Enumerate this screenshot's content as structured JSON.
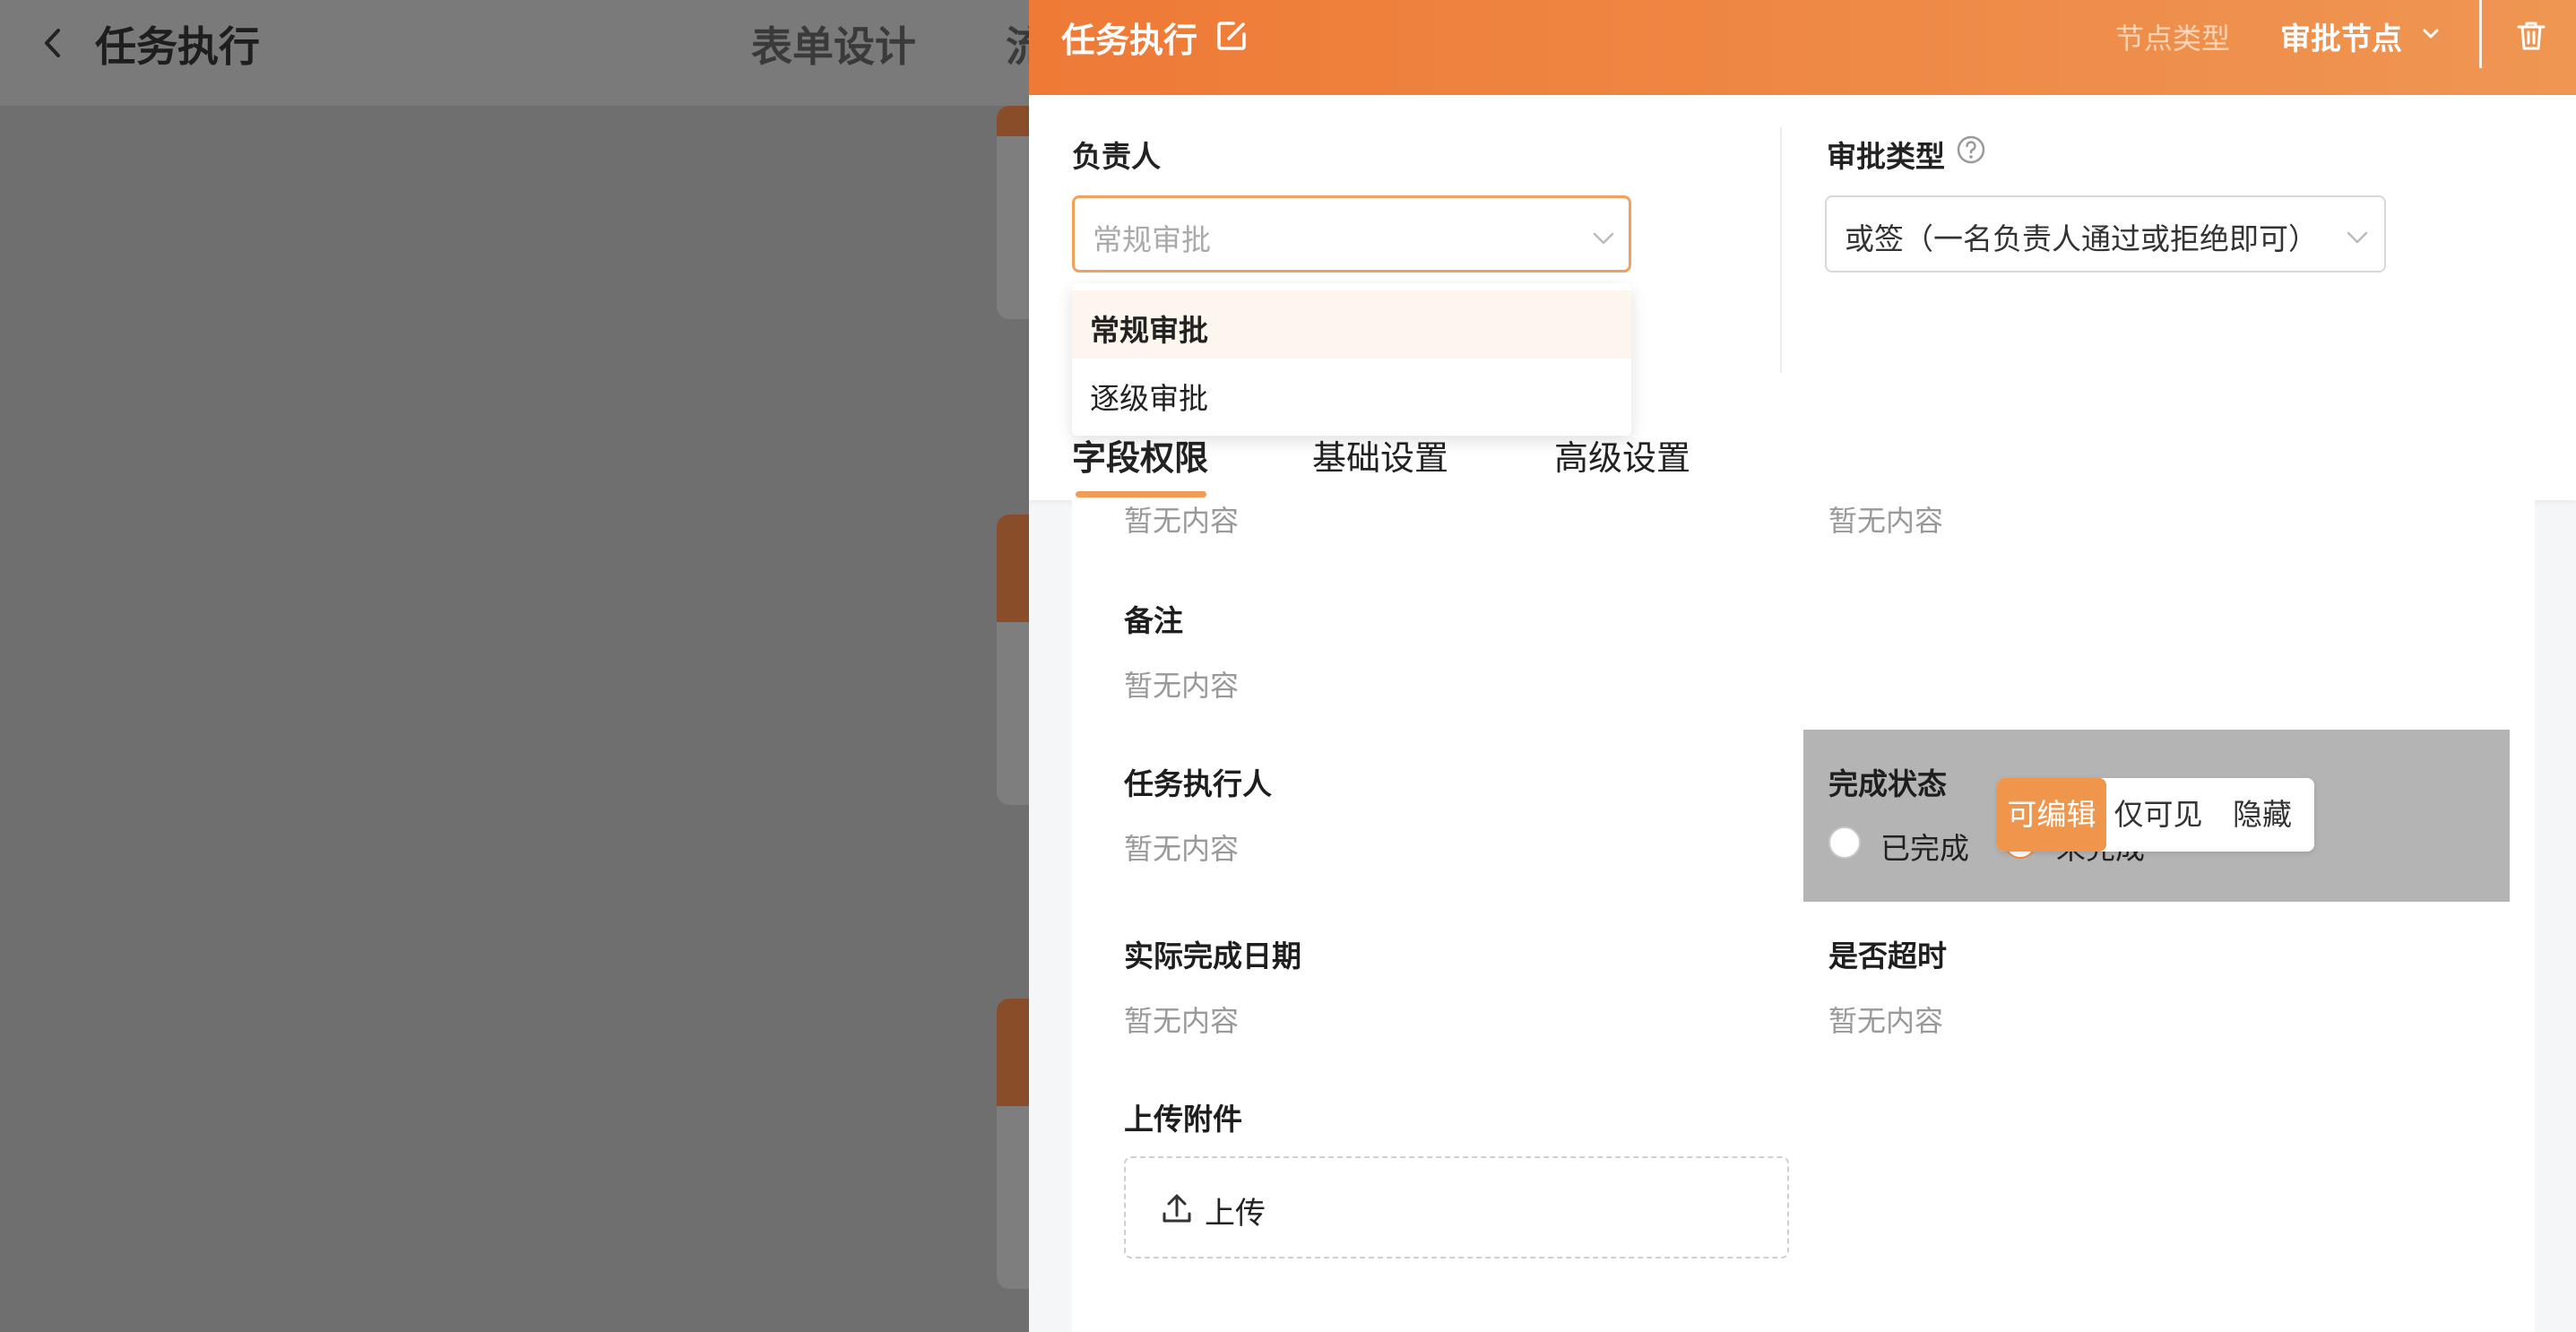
{
  "app": {
    "title": "任务执行",
    "tabs": [
      "表单设计",
      "流"
    ]
  },
  "drawer": {
    "title": "任务执行",
    "node_type_label": "节点类型",
    "node_type_value": "审批节点",
    "approver": {
      "label": "负责人",
      "placeholder": "常规审批",
      "options": [
        "常规审批",
        "逐级审批"
      ],
      "highlighted_option": "常规审批"
    },
    "approval_type": {
      "label": "审批类型",
      "value": "或签（一名负责人通过或拒绝即可）"
    },
    "tabs": [
      "字段权限",
      "基础设置",
      "高级设置"
    ],
    "active_tab": "字段权限"
  },
  "form": {
    "empty_text": "暂无内容",
    "fields": {
      "remark": "备注",
      "executor": "任务执行人",
      "completion_status": "完成状态",
      "actual_date": "实际完成日期",
      "overdue": "是否超时",
      "attachment": "上传附件"
    },
    "status_options": [
      "已完成",
      "未完成"
    ],
    "permissions": [
      "可编辑",
      "仅可见",
      "隐藏"
    ],
    "active_permission": "可编辑",
    "upload_label": "上传"
  },
  "colors": {
    "accent": "#ee7a36",
    "accent_light": "#f0954c",
    "overlay": "#6f6f6f"
  }
}
